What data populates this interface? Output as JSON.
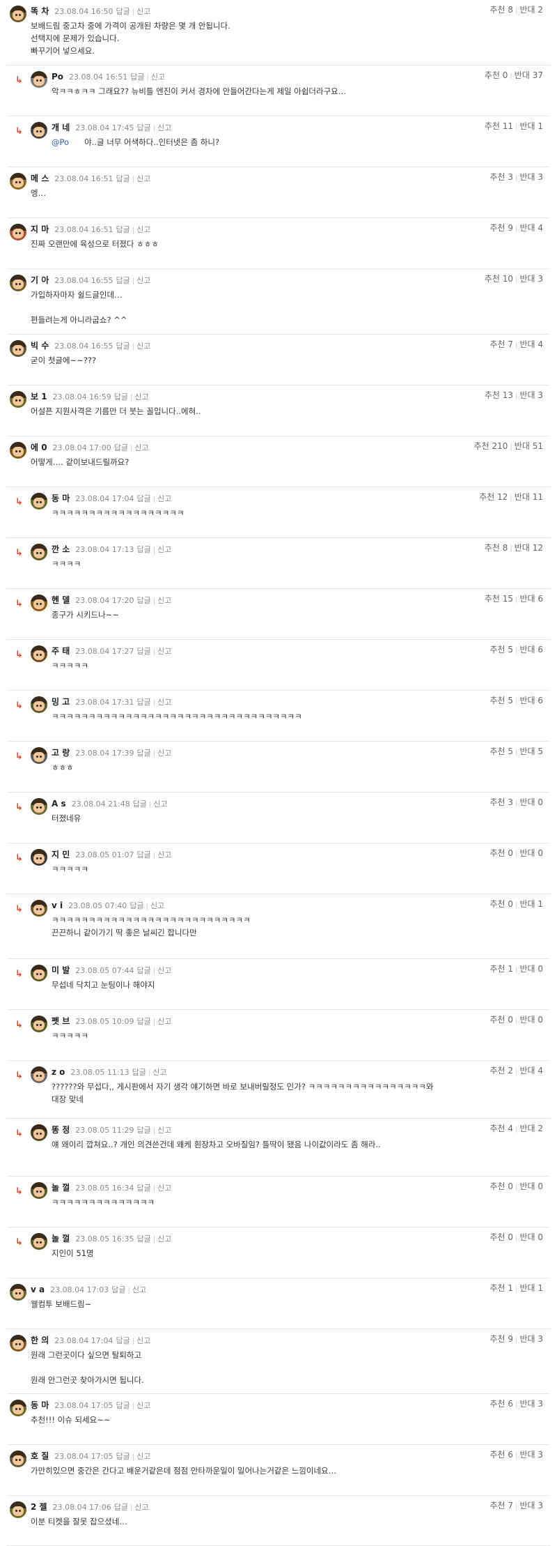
{
  "ui": {
    "reply_label": "답글",
    "report_label": "신고",
    "up_label": "추천",
    "down_label": "반대",
    "reply_arrow": "↳"
  },
  "comments": [
    {
      "nick": "똑 차",
      "date": "23.08.04 16:50",
      "up": "8",
      "down": "2",
      "body": "보배드림 중고차 중에 가격이 공개된 차량은 몇 개 안됩니다.\n선택지에 문제가 있습니다.\n빠꾸기어 넣으세요.",
      "reply": false,
      "avatar": "#6a5a2c"
    },
    {
      "nick": "Po",
      "date": "23.08.04 16:51",
      "up": "0",
      "down": "37",
      "body": "악ㅋㅋㅎㅋㅋ 그래요?? 뉴비틀 엔진이 커서 경차에 안들어간다는게 제일 아쉽더라구요…",
      "reply": true,
      "avatar": "#777777"
    },
    {
      "nick": "개 네",
      "date": "23.08.04 17:45",
      "up": "11",
      "down": "1",
      "mention": "@Po",
      "body": "야..글 너무 어색하다..인터넷은 좀 하니?",
      "reply": true,
      "avatar": "#4a4a4a"
    },
    {
      "nick": "메 스",
      "date": "23.08.04 16:51",
      "up": "3",
      "down": "3",
      "body": "엥…",
      "reply": false,
      "avatar": "#8a6a2a"
    },
    {
      "nick": "지 마",
      "date": "23.08.04 16:51",
      "up": "9",
      "down": "4",
      "body": "진짜 오랜만에 육성으로 터졌다 ㅎㅎㅎ",
      "reply": false,
      "avatar": "#b0503a"
    },
    {
      "nick": "기 아",
      "date": "23.08.04 16:55",
      "up": "10",
      "down": "3",
      "body": "가입하자마자 쉴드글인데…\n\n편들려는게 아니라굽쇼? ^^",
      "reply": false,
      "avatar": "#6a5a2c"
    },
    {
      "nick": "빅 수",
      "date": "23.08.04 16:55",
      "up": "7",
      "down": "4",
      "body": "굳이 첫글에~~???",
      "reply": false,
      "avatar": "#5a5a3a"
    },
    {
      "nick": "보 1",
      "date": "23.08.04 16:59",
      "up": "13",
      "down": "3",
      "body": "어설픈 지원사격은 기름만 더 붓는 꼴입니다..에혀..",
      "reply": false,
      "avatar": "#6a6a2a"
    },
    {
      "nick": "에 0",
      "date": "23.08.04 17:00",
      "up": "210",
      "down": "51",
      "body": "어떻게…. 같이보내드릴까요?",
      "reply": false,
      "avatar": "#7a5a1a"
    },
    {
      "nick": "동 마",
      "date": "23.08.04 17:04",
      "up": "12",
      "down": "11",
      "body": "ㅋㅋㅋㅋㅋㅋㅋㅋㅋㅋㅋㅋㅋㅋㅋㅋㅋㅋ",
      "reply": true,
      "avatar": "#6a6a2a"
    },
    {
      "nick": "깐 소",
      "date": "23.08.04 17:13",
      "up": "8",
      "down": "12",
      "body": "ㅋㅋㅋㅋ",
      "reply": true,
      "avatar": "#5a5a2a"
    },
    {
      "nick": "헨 델",
      "date": "23.08.04 17:20",
      "up": "15",
      "down": "6",
      "body": "종구가 시키드나~~",
      "reply": true,
      "avatar": "#8a5a1a"
    },
    {
      "nick": "주 태",
      "date": "23.08.04 17:27",
      "up": "5",
      "down": "6",
      "body": "ㅋㅋㅋㅋㅋ",
      "reply": true,
      "avatar": "#6a4a2a"
    },
    {
      "nick": "밍 고",
      "date": "23.08.04 17:31",
      "up": "5",
      "down": "6",
      "body": "ㅋㅋㅋㅋㅋㅋㅋㅋㅋㅋㅋㅋㅋㅋㅋㅋㅋㅋㅋㅋㅋㅋㅋㅋㅋㅋㅋㅋㅋㅋㅋㅋㅋㅋ",
      "reply": true,
      "avatar": "#5a5a2a"
    },
    {
      "nick": "고 랑",
      "date": "23.08.04 17:39",
      "up": "5",
      "down": "5",
      "body": "ㅎㅎㅎ",
      "reply": true,
      "avatar": "#5a5a5a"
    },
    {
      "nick": "A s",
      "date": "23.08.04 21:48",
      "up": "3",
      "down": "0",
      "body": "터졌네유",
      "reply": true,
      "avatar": "#6a6a3a"
    },
    {
      "nick": "지 민",
      "date": "23.08.05 01:07",
      "up": "0",
      "down": "0",
      "body": "ㅋㅋㅋㅋㅋ",
      "reply": true,
      "avatar": "#3a3a3a"
    },
    {
      "nick": "v i",
      "date": "23.08.05 07:40",
      "up": "0",
      "down": "1",
      "body": "ㅋㅋㅋㅋㅋㅋㅋㅋㅋㅋㅋㅋㅋㅋㅋㅋㅋㅋㅋㅋㅋㅋㅋㅋㅋㅋㅋ\n끈끈하니 같이가기 딱 좋은 날씨긴 합니다만",
      "reply": true,
      "avatar": "#6a5a2a"
    },
    {
      "nick": "미 발",
      "date": "23.08.05 07:44",
      "up": "1",
      "down": "0",
      "body": "무섭네 닥치고 눈팅이나 해야지",
      "reply": true,
      "avatar": "#5a5a2a"
    },
    {
      "nick": "펫 브",
      "date": "23.08.05 10:09",
      "up": "0",
      "down": "0",
      "body": "ㅋㅋㅋㅋㅋ",
      "reply": true,
      "avatar": "#5a5a2a"
    },
    {
      "nick": "z o",
      "date": "23.08.05 11:13",
      "up": "2",
      "down": "4",
      "body": "??????와 무섭다,, 게시판에서 자기 생각 얘기하면 바로 보내버릴정도 인가? ㅋㅋㅋㅋㅋㅋㅋㅋㅋㅋㅋㅋㅋㅋㅋㅋ와\n대장 맞네",
      "reply": true,
      "avatar": "#6a6a6a"
    },
    {
      "nick": "똥 정",
      "date": "23.08.05 11:29",
      "up": "4",
      "down": "2",
      "body": "얘 왜이리 깝쳐요..? 개인 의견쓴건데 왜케 흰장차고 오바질임? 틀딱이 됐음 나이값이라도 좀 해라..",
      "reply": true,
      "avatar": "#4a4a2a"
    },
    {
      "nick": "놀 껄",
      "date": "23.08.05 16:34",
      "up": "0",
      "down": "0",
      "body": "ㅋㅋㅋㅋㅋㅋㅋㅋㅋㅋㅋㅋㅋㅋ",
      "reply": true,
      "avatar": "#5a5a2a"
    },
    {
      "nick": "놀 껄",
      "date": "23.08.05 16:35",
      "up": "0",
      "down": "0",
      "body": "지인이 51명",
      "reply": true,
      "avatar": "#5a5a2a"
    },
    {
      "nick": "v a",
      "date": "23.08.04 17:03",
      "up": "1",
      "down": "1",
      "body": "웰컴투 보배드림~",
      "reply": false,
      "avatar": "#5a6a3a"
    },
    {
      "nick": "한 의",
      "date": "23.08.04 17:04",
      "up": "9",
      "down": "3",
      "body": "원래 그런곳이다 싶으면 탈퇴하고\n\n원래 안그런곳 찾아가시면 됩니다.",
      "reply": false,
      "avatar": "#7a5a2a"
    },
    {
      "nick": "동 마",
      "date": "23.08.04 17:05",
      "up": "6",
      "down": "3",
      "body": "추천!!! 이슈 되세요~~",
      "reply": false,
      "avatar": "#6a6a2a"
    },
    {
      "nick": "호 질",
      "date": "23.08.04 17:05",
      "up": "6",
      "down": "3",
      "body": "가만히있으면 중간은 간다고 배운거같은데 점점 안타까운일이 일어나는거같은 느낌이네요…",
      "reply": false,
      "avatar": "#5a5a3a"
    },
    {
      "nick": "2 젤",
      "date": "23.08.04 17:06",
      "up": "7",
      "down": "3",
      "body": "이분 티켓을 잘못 잡으셨네…",
      "reply": false,
      "avatar": "#6a6a2a"
    }
  ]
}
